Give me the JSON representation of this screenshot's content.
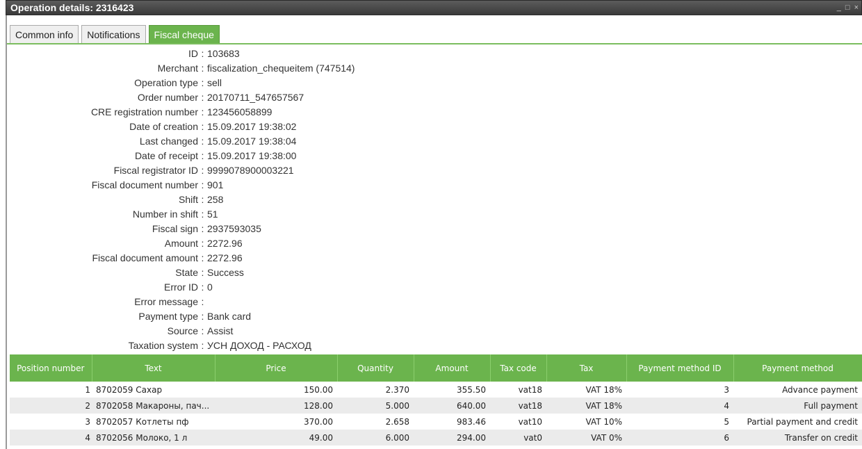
{
  "window": {
    "title": "Operation details: 2316423",
    "minimize_glyph": "_",
    "maximize_glyph": "□",
    "close_glyph": "×"
  },
  "tabs": [
    {
      "label": "Common info"
    },
    {
      "label": "Notifications"
    },
    {
      "label": "Fiscal cheque"
    }
  ],
  "details": [
    {
      "label": "ID",
      "value": "103683"
    },
    {
      "label": "Merchant",
      "value": "fiscalization_chequeitem (747514)"
    },
    {
      "label": "Operation type",
      "value": "sell"
    },
    {
      "label": "Order number",
      "value": "20170711_547657567"
    },
    {
      "label": "CRE registration number",
      "value": "123456058899"
    },
    {
      "label": "Date of creation",
      "value": "15.09.2017 19:38:02"
    },
    {
      "label": "Last changed",
      "value": "15.09.2017 19:38:04"
    },
    {
      "label": "Date of receipt",
      "value": "15.09.2017 19:38:00"
    },
    {
      "label": "Fiscal registrator ID",
      "value": "9999078900003221"
    },
    {
      "label": "Fiscal document number",
      "value": "901"
    },
    {
      "label": "Shift",
      "value": "258"
    },
    {
      "label": "Number in shift",
      "value": "51"
    },
    {
      "label": "Fiscal sign",
      "value": "2937593035"
    },
    {
      "label": "Amount",
      "value": "2272.96"
    },
    {
      "label": "Fiscal document amount",
      "value": "2272.96"
    },
    {
      "label": "State",
      "value": "Success"
    },
    {
      "label": "Error ID",
      "value": "0"
    },
    {
      "label": "Error message",
      "value": ""
    },
    {
      "label": "Payment type",
      "value": "Bank card"
    },
    {
      "label": "Source",
      "value": "Assist"
    },
    {
      "label": "Taxation system",
      "value": "УСН ДОХОД - РАСХОД"
    }
  ],
  "separator": ":",
  "table": {
    "headers": [
      "Position number",
      "Text",
      "Price",
      "Quantity",
      "Amount",
      "Tax code",
      "Tax",
      "Payment method ID",
      "Payment method"
    ],
    "rows": [
      [
        "1",
        "8702059 Сахар",
        "150.00",
        "2.370",
        "355.50",
        "vat18",
        "VAT 18%",
        "3",
        "Advance payment"
      ],
      [
        "2",
        "8702058 Макароны, пач...",
        "128.00",
        "5.000",
        "640.00",
        "vat18",
        "VAT 18%",
        "4",
        "Full payment"
      ],
      [
        "3",
        "8702057 Котлеты пф",
        "370.00",
        "2.658",
        "983.46",
        "vat10",
        "VAT 10%",
        "5",
        "Partial payment and credit"
      ],
      [
        "4",
        "8702056 Молоко, 1 л",
        "49.00",
        "6.000",
        "294.00",
        "vat0",
        "VAT 0%",
        "6",
        "Transfer on credit"
      ]
    ]
  },
  "colors": {
    "accent": "#6bb44d",
    "titlebar": "#444444",
    "alt_row": "#ebebeb"
  }
}
